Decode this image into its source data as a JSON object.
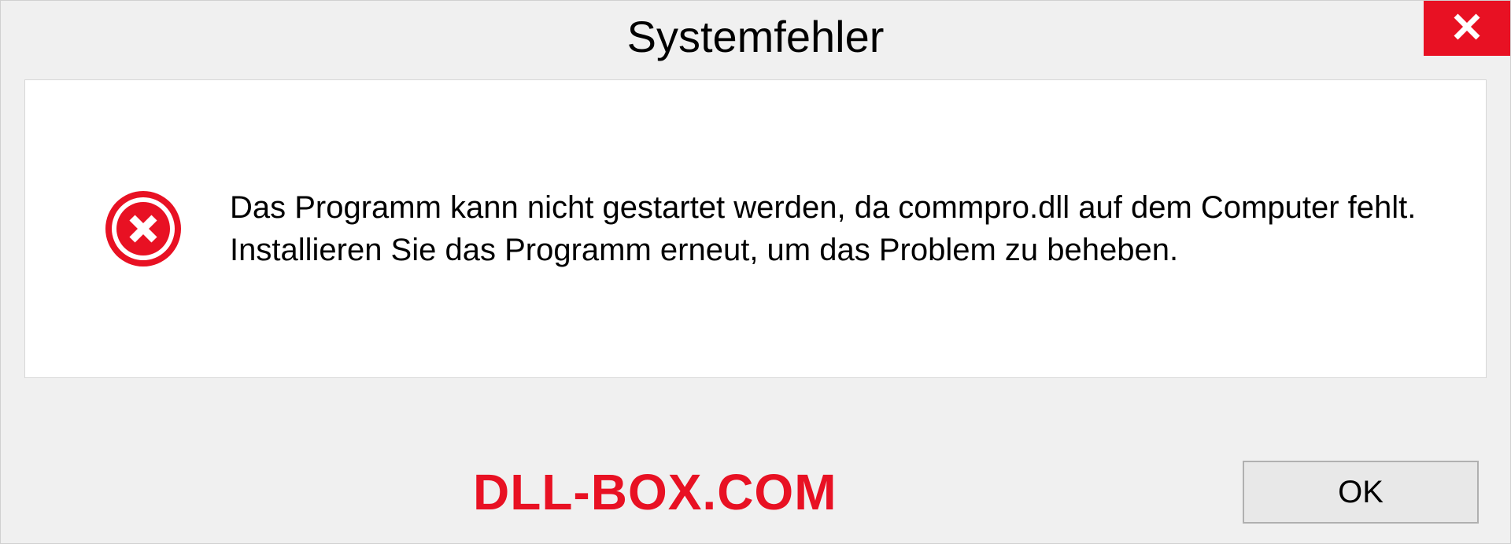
{
  "dialog": {
    "title": "Systemfehler",
    "message": "Das Programm kann nicht gestartet werden, da commpro.dll auf dem Computer fehlt. Installieren Sie das Programm erneut, um das Problem zu beheben.",
    "ok_button_label": "OK"
  },
  "watermark": {
    "text": "DLL-BOX.COM"
  },
  "colors": {
    "error_red": "#e81123",
    "background": "#f0f0f0",
    "content_bg": "#ffffff"
  }
}
